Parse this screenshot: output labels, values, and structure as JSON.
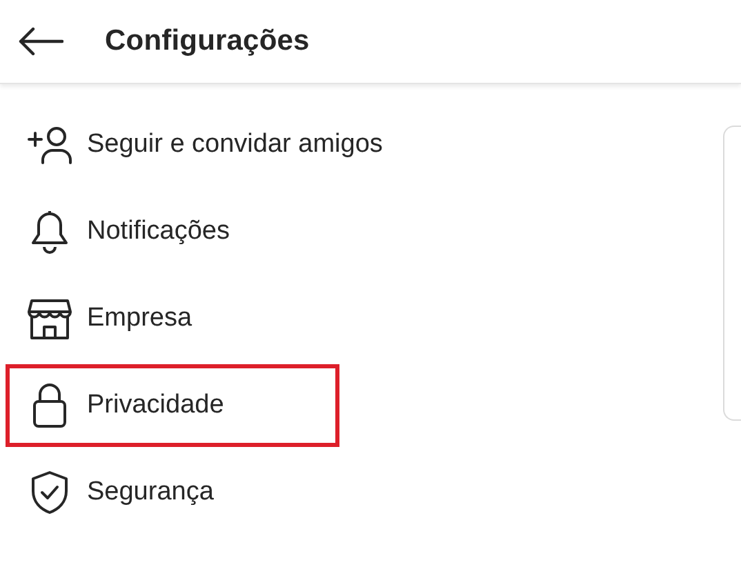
{
  "header": {
    "title": "Configurações"
  },
  "items": [
    {
      "kind": "follow",
      "label": "Seguir e convidar amigos",
      "highlighted": false
    },
    {
      "kind": "notify",
      "label": "Notificações",
      "highlighted": false
    },
    {
      "kind": "business",
      "label": "Empresa",
      "highlighted": false
    },
    {
      "kind": "privacy",
      "label": "Privacidade",
      "highlighted": true
    },
    {
      "kind": "security",
      "label": "Segurança",
      "highlighted": false
    }
  ]
}
